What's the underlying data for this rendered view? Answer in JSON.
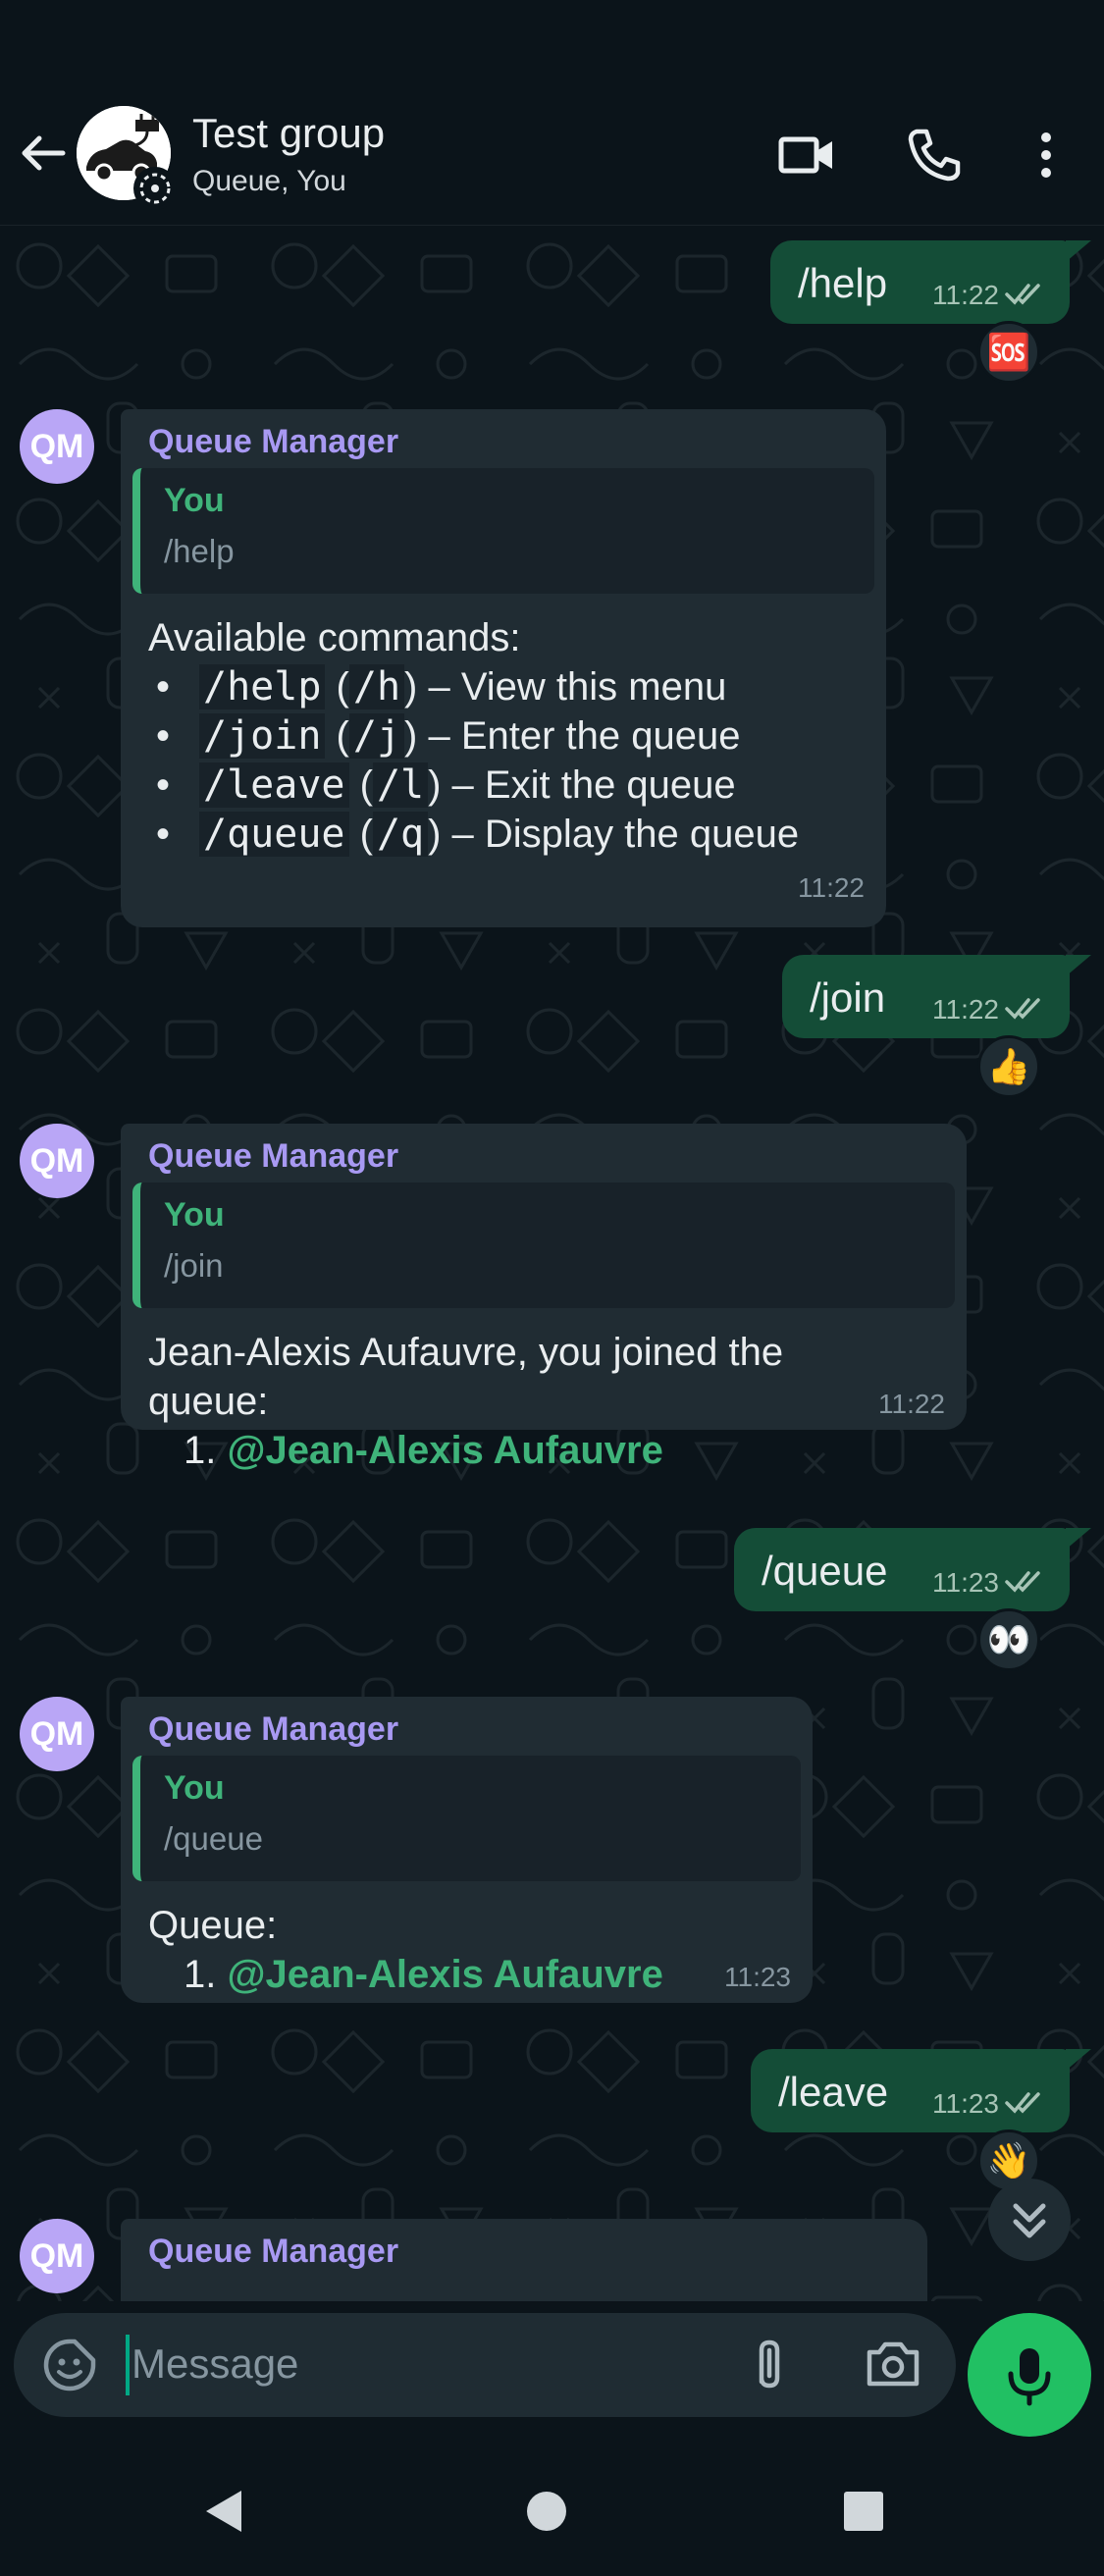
{
  "header": {
    "title": "Test group",
    "subtitle": "Queue, You",
    "icons": [
      "back-arrow-icon",
      "video-call-icon",
      "voice-call-icon",
      "more-options-icon"
    ]
  },
  "messages": {
    "m1": {
      "text": "/help",
      "time": "11:22",
      "reaction": "🆘"
    },
    "m2": {
      "sender": "Queue Manager",
      "avatar": "QM",
      "quote_name": "You",
      "quote_text": "/help",
      "intro": "Available commands:",
      "lines": [
        {
          "bullet": "•",
          "cmd": "/help",
          "alias": "/h",
          "desc": " – View this menu"
        },
        {
          "bullet": "•",
          "cmd": "/join",
          "alias": "/j",
          "desc": " – Enter the queue"
        },
        {
          "bullet": "•",
          "cmd": "/leave",
          "alias": "/l",
          "desc": " – Exit the queue"
        },
        {
          "bullet": "•",
          "cmd": "/queue",
          "alias": "/q",
          "desc": " – Display the queue"
        }
      ],
      "time": "11:22"
    },
    "m3": {
      "text": "/join",
      "time": "11:22",
      "reaction": "👍"
    },
    "m4": {
      "sender": "Queue Manager",
      "avatar": "QM",
      "quote_name": "You",
      "quote_text": "/join",
      "line1": "Jean-Alexis Aufauvre, you joined the",
      "line2": "queue:",
      "item_num": "1.",
      "item_mention": "@Jean-Alexis Aufauvre",
      "time": "11:22"
    },
    "m5": {
      "text": "/queue",
      "time": "11:23",
      "reaction": "👀"
    },
    "m6": {
      "sender": "Queue Manager",
      "avatar": "QM",
      "quote_name": "You",
      "quote_text": "/queue",
      "line1": "Queue:",
      "item_num": "1.",
      "item_mention": "@Jean-Alexis Aufauvre",
      "time": "11:23"
    },
    "m7": {
      "text": "/leave",
      "time": "11:23",
      "reaction": "👋"
    },
    "m8": {
      "sender": "Queue Manager",
      "avatar": "QM"
    }
  },
  "composer": {
    "placeholder": "Message"
  },
  "colors": {
    "outgoing_bubble": "#144d37",
    "incoming_bubble": "#202c33",
    "sender_name": "#a899f2",
    "mention": "#3fb37a",
    "mic_button": "#21c063"
  }
}
